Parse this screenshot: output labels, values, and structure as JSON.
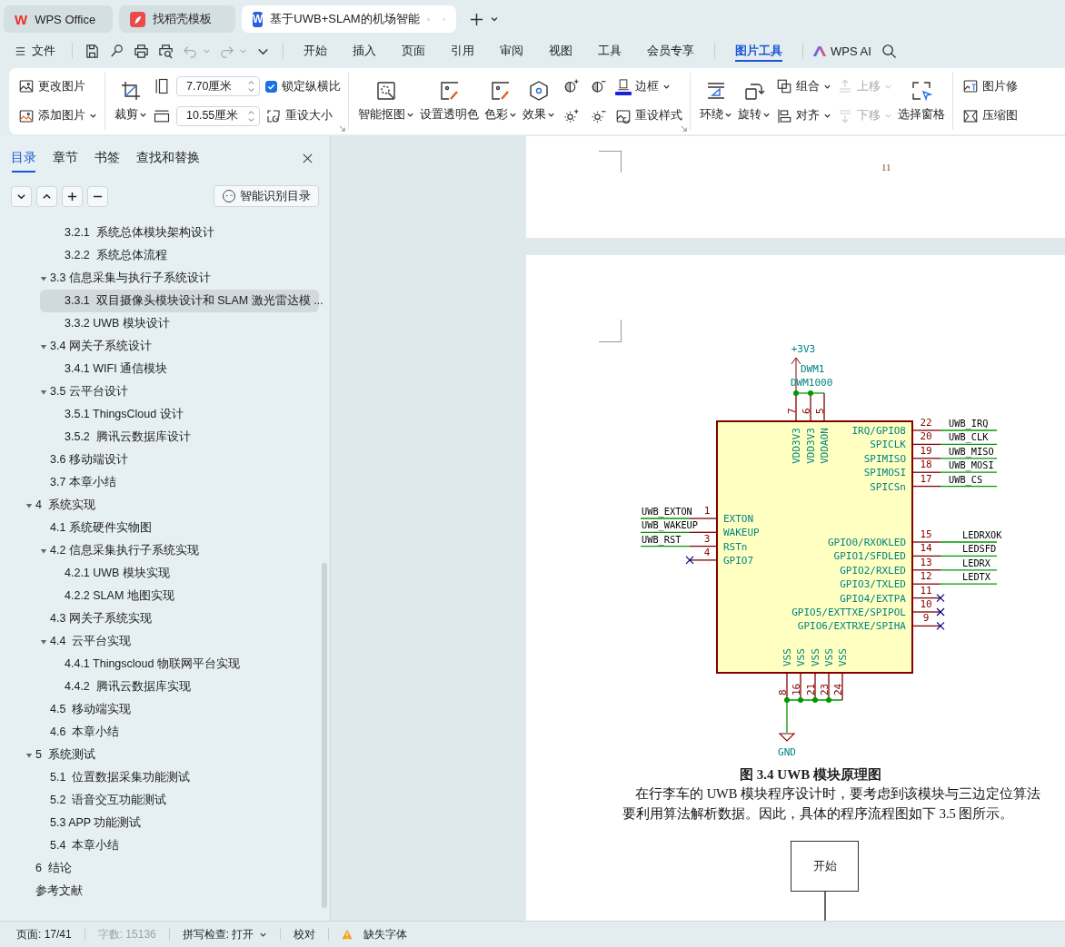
{
  "tabs": [
    {
      "kind": "wps",
      "logo": "W",
      "label": "WPS Office",
      "selected": false
    },
    {
      "kind": "docer",
      "label": "找稻壳模板",
      "selected": false
    },
    {
      "kind": "writer",
      "logo": "W",
      "label": "基于UWB+SLAM的机场智能",
      "selected": true
    }
  ],
  "menu": {
    "file": "文件",
    "tabs": [
      {
        "label": "开始",
        "selected": false
      },
      {
        "label": "插入",
        "selected": false
      },
      {
        "label": "页面",
        "selected": false
      },
      {
        "label": "引用",
        "selected": false
      },
      {
        "label": "审阅",
        "selected": false
      },
      {
        "label": "视图",
        "selected": false
      },
      {
        "label": "工具",
        "selected": false
      },
      {
        "label": "会员专享",
        "selected": false
      }
    ],
    "context_tabs": [
      {
        "label": "图片工具",
        "selected": true
      }
    ],
    "ai": "WPS AI"
  },
  "ribbon": [
    {
      "launcher": false,
      "columns": [
        [
          {
            "kind": "small",
            "label": "更改图片",
            "dropdown": false
          },
          {
            "kind": "small",
            "label": "添加图片",
            "dropdown": true
          }
        ]
      ]
    },
    {
      "launcher": true,
      "columns": [
        [
          {
            "kind": "large",
            "label": "裁剪",
            "dropdown": true
          }
        ],
        [
          {
            "kind": "field",
            "value": "7.70厘米"
          },
          {
            "kind": "field",
            "value": "10.55厘米"
          }
        ],
        [
          {
            "kind": "check",
            "label": "锁定纵横比",
            "checked": true
          },
          {
            "kind": "small",
            "label": "重设大小",
            "dropdown": false
          }
        ]
      ]
    },
    {
      "launcher": true,
      "columns": [
        [
          {
            "kind": "large",
            "label": "智能抠图",
            "dropdown": true
          }
        ],
        [
          {
            "kind": "large",
            "label": "设置透明色",
            "dropdown": false
          }
        ],
        [
          {
            "kind": "large",
            "label": "色彩",
            "dropdown": true
          }
        ],
        [
          {
            "kind": "large",
            "label": "效果",
            "dropdown": true
          }
        ],
        [
          {
            "kind": "icon"
          },
          {
            "kind": "icon"
          }
        ],
        [
          {
            "kind": "icon"
          },
          {
            "kind": "icon"
          }
        ],
        [
          {
            "kind": "small",
            "label": "边框",
            "dropdown": true,
            "color": "#1a22d8"
          },
          {
            "kind": "small",
            "label": "重设样式",
            "dropdown": false
          }
        ]
      ]
    },
    {
      "launcher": false,
      "columns": [
        [
          {
            "kind": "large",
            "label": "环绕",
            "dropdown": true,
            "disabled": false
          }
        ],
        [
          {
            "kind": "large",
            "label": "旋转",
            "dropdown": true,
            "disabled": false
          }
        ],
        [
          {
            "kind": "small",
            "label": "组合",
            "dropdown": true,
            "disabled": false
          },
          {
            "kind": "small",
            "label": "对齐",
            "dropdown": true,
            "disabled": false
          }
        ],
        [
          {
            "kind": "small",
            "label": "上移",
            "dropdown": true,
            "disabled": true
          },
          {
            "kind": "small",
            "label": "下移",
            "dropdown": true,
            "disabled": true
          }
        ],
        [
          {
            "kind": "large",
            "label": "选择窗格",
            "dropdown": false,
            "disabled": false
          }
        ]
      ]
    },
    {
      "launcher": false,
      "columns": [
        [
          {
            "kind": "small",
            "label": "图片修",
            "dropdown": false
          },
          {
            "kind": "small",
            "label": "压缩图",
            "dropdown": false
          }
        ]
      ]
    }
  ],
  "sidebar": {
    "tabs": [
      {
        "label": "目录",
        "selected": true
      },
      {
        "label": "章节",
        "selected": false
      },
      {
        "label": "书签",
        "selected": false
      },
      {
        "label": "查找和替换",
        "selected": false
      }
    ],
    "smart_button": "智能识别目录",
    "toc": [
      {
        "children": [
          {
            "children": [
              {
                "label": "3.2.1  系统总体模块架构设计",
                "selected": false
              },
              {
                "label": "3.2.2  系统总体流程",
                "selected": false
              }
            ]
          },
          {
            "label": "3.3 信息采集与执行子系统设计",
            "selected": false,
            "expanded": true,
            "children": [
              {
                "label": "3.3.1  双目摄像头模块设计和 SLAM 激光雷达模 ...",
                "selected": true
              },
              {
                "label": "3.3.2 UWB 模块设计",
                "selected": false
              }
            ]
          },
          {
            "label": "3.4 网关子系统设计",
            "selected": false,
            "expanded": true,
            "children": [
              {
                "label": "3.4.1 WIFI 通信模块",
                "selected": false
              }
            ]
          },
          {
            "label": "3.5 云平台设计",
            "selected": false,
            "expanded": true,
            "children": [
              {
                "label": "3.5.1 ThingsCloud 设计",
                "selected": false
              },
              {
                "label": "3.5.2  腾讯云数据库设计",
                "selected": false
              }
            ]
          },
          {
            "label": "3.6 移动端设计",
            "selected": false
          },
          {
            "label": "3.7 本章小结",
            "selected": false
          }
        ]
      },
      {
        "label": "4  系统实现",
        "selected": false,
        "expanded": true,
        "children": [
          {
            "label": "4.1 系统硬件实物图",
            "selected": false
          },
          {
            "label": "4.2 信息采集执行子系统实现",
            "selected": false,
            "expanded": true,
            "children": [
              {
                "label": "4.2.1 UWB 模块实现",
                "selected": false
              },
              {
                "label": "4.2.2 SLAM 地图实现",
                "selected": false
              }
            ]
          },
          {
            "label": "4.3 网关子系统实现",
            "selected": false
          },
          {
            "label": "4.4  云平台实现",
            "selected": false,
            "expanded": true,
            "children": [
              {
                "label": "4.4.1 Thingscloud 物联网平台实现",
                "selected": false
              },
              {
                "label": "4.4.2  腾讯云数据库实现",
                "selected": false
              }
            ]
          },
          {
            "label": "4.5  移动端实现",
            "selected": false
          },
          {
            "label": "4.6  本章小结",
            "selected": false
          }
        ]
      },
      {
        "label": "5  系统测试",
        "selected": false,
        "expanded": true,
        "children": [
          {
            "label": "5.1  位置数据采集功能测试",
            "selected": false
          },
          {
            "label": "5.2  语音交互功能测试",
            "selected": false
          },
          {
            "label": "5.3 APP 功能测试",
            "selected": false
          },
          {
            "label": "5.4  本章小结",
            "selected": false
          }
        ]
      },
      {
        "label": "6  结论",
        "selected": false
      },
      {
        "label": "参考文献",
        "selected": false
      }
    ]
  },
  "document": {
    "page_number": "11",
    "schematic": {
      "power": "+3V3",
      "reference": "DWM1",
      "value": "DWM1000",
      "ground": "GND",
      "top_pins": [
        {
          "number": "7",
          "name": "VDD3V3"
        },
        {
          "number": "6",
          "name": "VDD3V3"
        },
        {
          "number": "5",
          "name": "VDDAON"
        }
      ],
      "right_pins": [
        {
          "number": "22",
          "name": "IRQ/GPIO8",
          "kind": "net",
          "net": "UWB_IRQ"
        },
        {
          "number": "20",
          "name": "SPICLK",
          "kind": "net",
          "net": "UWB_CLK"
        },
        {
          "number": "19",
          "name": "SPIMISO",
          "kind": "net",
          "net": "UWB_MISO"
        },
        {
          "number": "18",
          "name": "SPIMOSI",
          "kind": "net",
          "net": "UWB_MOSI"
        },
        {
          "number": "17",
          "name": "SPICSn",
          "kind": "net",
          "net": "UWB_CS"
        },
        {
          "number": "15",
          "name": "GPIO0/RXOKLED",
          "kind": "net",
          "net": "LEDRXOK"
        },
        {
          "number": "14",
          "name": "GPIO1/SFDLED",
          "kind": "net",
          "net": "LEDSFD"
        },
        {
          "number": "13",
          "name": "GPIO2/RXLED",
          "kind": "net",
          "net": "LEDRX"
        },
        {
          "number": "12",
          "name": "GPIO3/TXLED",
          "kind": "net",
          "net": "LEDTX"
        },
        {
          "number": "11",
          "name": "GPIO4/EXTPA",
          "kind": "nc"
        },
        {
          "number": "10",
          "name": "GPIO5/EXTTXE/SPIPOL",
          "kind": "nc"
        },
        {
          "number": "9",
          "name": "GPIO6/EXTRXE/SPIHA",
          "kind": "nc"
        }
      ],
      "left_pins": [
        {
          "number": "1",
          "name": "EXTON",
          "kind": "net",
          "net": "UWB_EXTON"
        },
        {
          "name": "WAKEUP",
          "kind": "net",
          "net": "UWB_WAKEUP"
        },
        {
          "number": "3",
          "name": "RSTn",
          "kind": "net",
          "net": "UWB_RST"
        },
        {
          "number": "4",
          "name": "GPIO7",
          "kind": "nc"
        }
      ],
      "bottom_pins": [
        {
          "number": "8",
          "name": "VSS"
        },
        {
          "number": "16",
          "name": "VSS"
        },
        {
          "number": "21",
          "name": "VSS"
        },
        {
          "number": "23",
          "name": "VSS"
        },
        {
          "number": "24",
          "name": "VSS"
        }
      ]
    },
    "caption": "图 3.4 UWB 模块原理图",
    "paragraph": [
      "在行李车的 UWB 模块程序设计时，要考虑到该模块与三边定位算法",
      "要利用算法解析数据。因此，具体的程序流程图如下 3.5 图所示。"
    ],
    "flow_node": "开始"
  },
  "status_bar": [
    {
      "kind": "text",
      "label": "页面: 17/41",
      "disabled": false
    },
    {
      "kind": "text",
      "label": "字数: 15136",
      "disabled": true
    },
    {
      "kind": "dropdown",
      "label": "拼写检查: 打开",
      "disabled": false
    },
    {
      "kind": "text",
      "label": "校对",
      "disabled": false
    },
    {
      "kind": "warning",
      "label": "缺失字体",
      "disabled": false
    }
  ]
}
